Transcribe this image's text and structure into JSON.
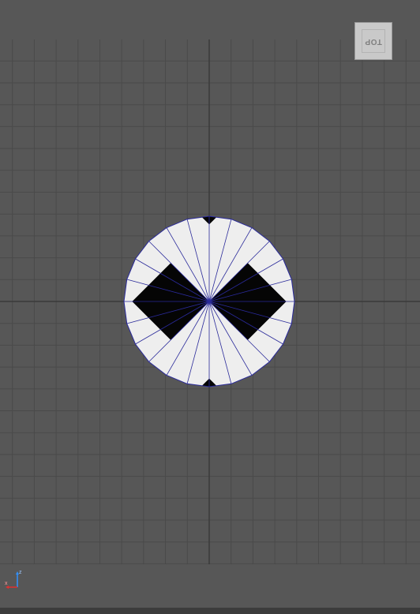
{
  "viewport": {
    "name": "Top",
    "view_cube_label": "TOP",
    "colors": {
      "background": "#575757",
      "grid_line": "#4a4a4a",
      "axis_line": "#3a3a3a",
      "face_white": "#eeeeee",
      "face_black": "#050505",
      "wire_edge": "#2a2a9a"
    }
  },
  "axis_gizmo": {
    "z_label": "z",
    "x_label": "x",
    "x_color": "#e03030",
    "z_color": "#3090ff"
  }
}
